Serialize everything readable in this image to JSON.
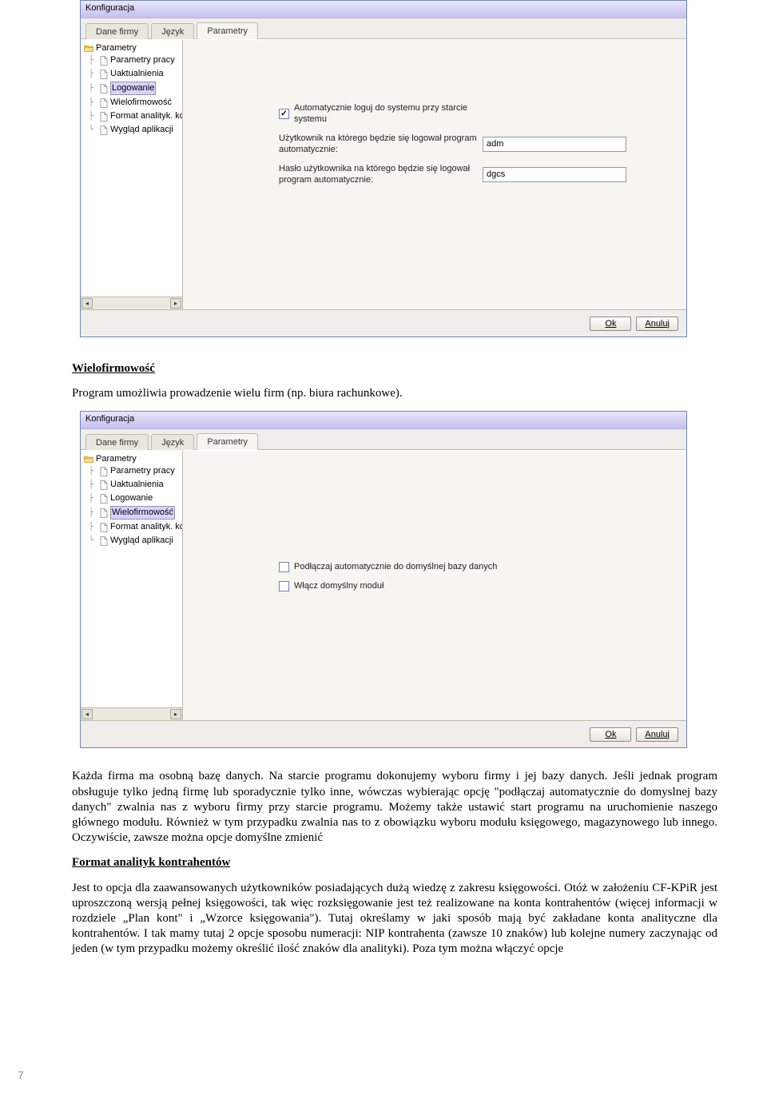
{
  "dialogTitle": "Konfiguracja",
  "tabs": {
    "daneFirmy": "Dane firmy",
    "jezyk": "Język",
    "parametry": "Parametry"
  },
  "tree": {
    "root": "Parametry",
    "items": [
      "Parametry pracy",
      "Uaktualnienia",
      "Logowanie",
      "Wielofirmowość",
      "Format analityk. kontr",
      "Wygląd aplikacji"
    ]
  },
  "logowanie": {
    "autoLoginLabel": "Automatycznie loguj do systemu przy starcie systemu",
    "userLabel": "Użytkownik na którego będzie się logował program automatycznie:",
    "userValue": "adm",
    "passLabel": "Hasło użytkownika na którego będzie się logował program automatycznie:",
    "passValue": "dgcs"
  },
  "wielof": {
    "autoDbLabel": "Podłączaj automatycznie do domyślnej bazy danych",
    "defModLabel": "Włącz domyślny moduł"
  },
  "buttons": {
    "ok": "Ok",
    "cancel": "Anuluj"
  },
  "doc": {
    "h1": "Wielofirmowość",
    "p1": "Program umożliwia prowadzenie wielu firm (np. biura rachunkowe).",
    "p2a": "Każda firma ma osobną bazę danych. Na starcie programu dokonujemy wyboru firmy i jej bazy danych. Jeśli jednak program obsługuje tylko jedną firmę lub sporadycznie tylko inne, wówczas wybierając opcję \"podłączaj automatycznie do domyslnej bazy danych\" zwalnia nas z wyboru firmy przy starcie programu. Możemy także ustawić start programu na uruchomienie naszego głównego modułu. Również w tym przypadku zwalnia nas to z obowiązku wyboru modułu księgowego, magazynowego lub innego. Oczywiście, zawsze można opcje domyślne zmienić",
    "h2": "Format analityk kontrahentów",
    "p3": "Jest to opcja dla zaawansowanych użytkowników posiadających dużą wiedzę z zakresu księgowości. Otóż w założeniu CF-KPiR jest uproszczoną wersją pełnej księgowości, tak więc rozksięgowanie jest też realizowane na konta kontrahentów (więcej informacji w rozdziele „Plan kont\" i „Wzorce księgowania\"). Tutaj określamy w jaki sposób mają być zakładane konta analityczne dla kontrahentów. I tak mamy tutaj 2 opcje sposobu numeracji: NIP kontrahenta (zawsze 10 znaków) lub kolejne numery zaczynając od jeden (w tym przypadku możemy określić ilość znaków dla analityki). Poza tym można włączyć opcje"
  },
  "pageNumber": "7"
}
